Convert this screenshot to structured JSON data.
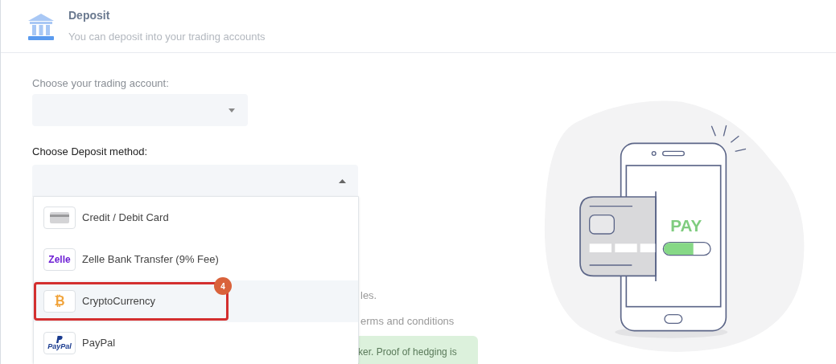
{
  "header": {
    "title": "Deposit",
    "subtitle": "You can deposit into your trading accounts"
  },
  "account_field": {
    "label": "Choose your trading account:"
  },
  "method_field": {
    "label": "Choose Deposit method:",
    "expanded": true
  },
  "methods": [
    {
      "kind": "card",
      "label": "Credit / Debit Card",
      "selected": false
    },
    {
      "kind": "zelle",
      "label": "Zelle Bank Transfer (9% Fee)",
      "icon_text": "Zelle",
      "selected": false
    },
    {
      "kind": "crypto",
      "label": "CryptoCurrency",
      "icon_text": "₿",
      "selected": true
    },
    {
      "kind": "paypal",
      "label": "PayPal",
      "icon_text": "PayPal",
      "selected": false
    }
  ],
  "annotation": {
    "badge": "4"
  },
  "hidden_texts": [
    "les.",
    "erms and conditions"
  ],
  "notice": "ker. Proof of hedging is",
  "illustration": {
    "screen_text": "PAY"
  }
}
